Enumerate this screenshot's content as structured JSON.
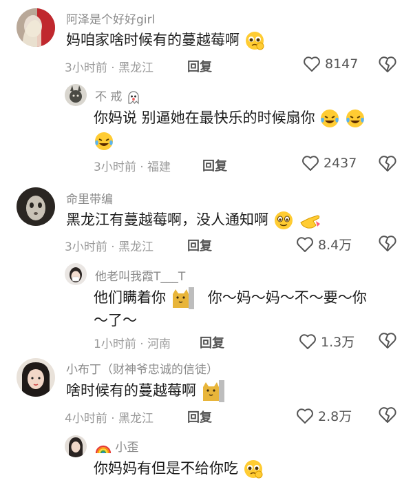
{
  "comments": [
    {
      "author": "阿泽是个好好girl",
      "text": "妈咱家啥时候有的蔓越莓啊",
      "time_location": "3小时前 · 黑龙江",
      "reply_label": "回复",
      "likes": "8147"
    },
    {
      "author": "不 戒",
      "text": "你妈说 别逼她在最快乐的时候扇你",
      "time_location": "3小时前 · 福建",
      "reply_label": "回复",
      "likes": "2437"
    },
    {
      "author": "命里带编",
      "text": "黑龙江有蔓越莓啊，没人通知啊",
      "time_location": "3小时前 · 黑龙江",
      "reply_label": "回复",
      "likes": "8.4万"
    },
    {
      "author": "他老叫我霞T___T",
      "text_part1": "他们瞒着你",
      "text_part2": "你～妈～妈～不～要～你",
      "text_line2": "～了～",
      "time_location": "1小时前 · 河南",
      "reply_label": "回复",
      "likes": "1.3万"
    },
    {
      "author": "小布丁（财神爷忠诚的信徒）",
      "text": "啥时候有的蔓越莓啊",
      "time_location": "4小时前 · 黑龙江",
      "reply_label": "回复",
      "likes": "2.8万"
    },
    {
      "author": "小歪",
      "text": "你妈妈有但是不给你吃"
    }
  ],
  "colors": {
    "text": "#1c1c1c",
    "secondary": "#8a8a8a",
    "icon": "#555555",
    "background": "#ffffff"
  }
}
